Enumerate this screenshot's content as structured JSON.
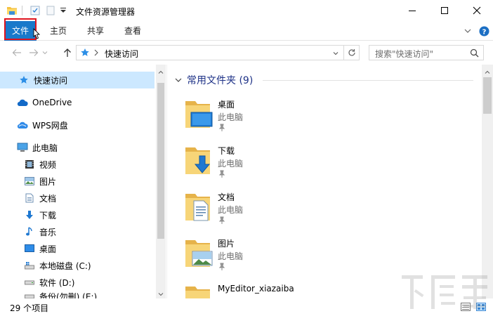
{
  "window": {
    "title": "文件资源管理器"
  },
  "ribbon": {
    "tabs": [
      {
        "label": "文件",
        "active": true
      },
      {
        "label": "主页"
      },
      {
        "label": "共享"
      },
      {
        "label": "查看"
      }
    ]
  },
  "address": {
    "path": "快速访问",
    "search_placeholder": "搜索\"快速访问\""
  },
  "nav": {
    "items": [
      {
        "label": "快速访问",
        "icon": "star-icon"
      },
      {
        "label": "OneDrive",
        "icon": "cloud-icon"
      },
      {
        "label": "WPS网盘",
        "icon": "wps-cloud-icon"
      },
      {
        "label": "此电脑",
        "icon": "computer-icon"
      },
      {
        "label": "视频",
        "icon": "video-icon"
      },
      {
        "label": "图片",
        "icon": "pictures-icon"
      },
      {
        "label": "文档",
        "icon": "documents-icon"
      },
      {
        "label": "下载",
        "icon": "download-icon"
      },
      {
        "label": "音乐",
        "icon": "music-icon"
      },
      {
        "label": "桌面",
        "icon": "desktop-icon"
      },
      {
        "label": "本地磁盘 (C:)",
        "icon": "drive-c-icon"
      },
      {
        "label": "软件 (D:)",
        "icon": "drive-d-icon"
      },
      {
        "label": "备份(勿删) (E:)",
        "icon": "drive-e-icon"
      }
    ]
  },
  "content": {
    "group_title": "常用文件夹 (9)",
    "folders": [
      {
        "name": "桌面",
        "location": "此电脑",
        "icon": "desktop-folder-icon"
      },
      {
        "name": "下载",
        "location": "此电脑",
        "icon": "download-folder-icon"
      },
      {
        "name": "文档",
        "location": "此电脑",
        "icon": "documents-folder-icon"
      },
      {
        "name": "图片",
        "location": "此电脑",
        "icon": "pictures-folder-icon"
      },
      {
        "name": "MyEditor_xiazaiba",
        "location": "",
        "icon": "folder-icon"
      }
    ]
  },
  "status": {
    "count": "29 个项目"
  },
  "colors": {
    "accent": "#1979ca",
    "highlight_outline": "#e0141e",
    "selected_nav": "#cce8ff",
    "group_header": "#1e3287"
  }
}
